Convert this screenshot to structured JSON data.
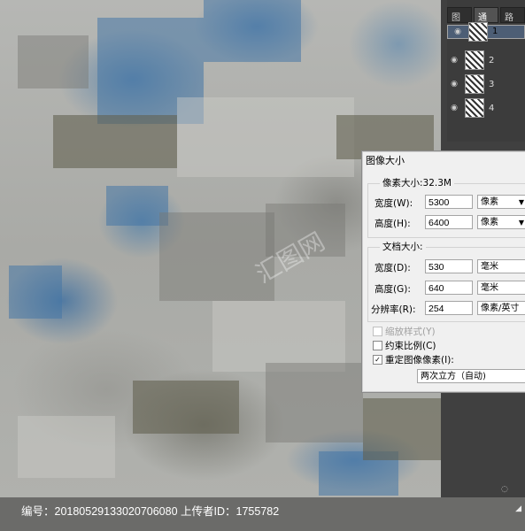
{
  "layers_panel": {
    "tabs": [
      "图层",
      "通道",
      "路径"
    ],
    "layers": [
      {
        "name": "1",
        "selected": true
      },
      {
        "name": "2",
        "selected": false
      },
      {
        "name": "3",
        "selected": false
      },
      {
        "name": "4",
        "selected": false
      }
    ]
  },
  "dialog": {
    "title": "图像大小",
    "pixel_dimensions_label": "像素大小:32.3M",
    "width_label": "宽度(W):",
    "width_value": "5300",
    "width_unit": "像素",
    "height_label": "高度(H):",
    "height_value": "6400",
    "height_unit": "像素",
    "doc_size_label": "文档大小:",
    "doc_width_label": "宽度(D):",
    "doc_width_value": "530",
    "doc_width_unit": "毫米",
    "doc_height_label": "高度(G):",
    "doc_height_value": "640",
    "doc_height_unit": "毫米",
    "resolution_label": "分辨率(R):",
    "resolution_value": "254",
    "resolution_unit": "像素/英寸",
    "scale_styles_label": "缩放样式(Y)",
    "constrain_label": "约束比例(C)",
    "resample_label": "重定图像像素(I):",
    "resample_method": "两次立方（自动)"
  },
  "caption": "编号：20180529133020706080 上传者ID：1755782",
  "watermark_text": "汇图网"
}
